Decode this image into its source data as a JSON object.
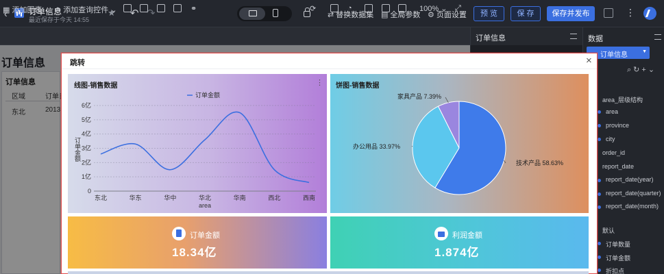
{
  "header": {
    "title": "订单信息",
    "subtitle": "最近保存于今天 14:55",
    "actions": [
      "替换数据集",
      "全局参数",
      "页面设置"
    ],
    "preview_label": "预 览",
    "save_label": "保 存",
    "publish_label": "保存并发布"
  },
  "toolbar": {
    "add_chart": "添加图表",
    "add_query": "添加查询控件",
    "zoom": "100%"
  },
  "canvas": {
    "page_title": "订单信息",
    "card_title": "订单信息",
    "columns": [
      "区域",
      "订单日"
    ],
    "row": [
      "东北",
      "2013"
    ]
  },
  "middle_panel": {
    "title": "订单信息"
  },
  "data_panel": {
    "title": "数据",
    "dataset": "订单信息",
    "fields": [
      "area_层级结构",
      "area",
      "province",
      "city",
      "order_id",
      "report_date",
      "report_date(year)",
      "report_date(quarter)",
      "report_date(month)"
    ],
    "group_label": "默认",
    "measures": [
      "订单数量",
      "订单金额",
      "折扣点"
    ]
  },
  "modal": {
    "title": "跳转",
    "close": "×"
  },
  "line_card": {
    "title": "线图-销售数据",
    "more": "⋮"
  },
  "pie_card": {
    "title": "饼图-销售数据"
  },
  "kpi": [
    {
      "label": "订单金额",
      "value": "18.34亿"
    },
    {
      "label": "利润金额",
      "value": "1.874亿"
    }
  ],
  "chart_data": [
    {
      "type": "line",
      "title": "线图-销售数据",
      "categories": [
        "东北",
        "华东",
        "华中",
        "华北",
        "华南",
        "西北",
        "西南"
      ],
      "series": [
        {
          "name": "订单金额",
          "values": [
            2.6,
            3.3,
            1.5,
            3.6,
            5.5,
            1.5,
            0.6
          ],
          "color": "#3b6fe0"
        }
      ],
      "xlabel": "area",
      "ylabel": "订单金额",
      "yticks": [
        "0",
        "1亿",
        "2亿",
        "3亿",
        "4亿",
        "5亿",
        "6亿"
      ],
      "ylim": [
        0,
        6
      ],
      "legend": "top",
      "grid": true
    },
    {
      "type": "pie",
      "title": "饼图-销售数据",
      "slices": [
        {
          "label": "技术产品",
          "value": 58.63,
          "text": "技术产品 58.63%",
          "color": "#3f7bea"
        },
        {
          "label": "办公用品",
          "value": 33.97,
          "text": "办公用品 33.97%",
          "color": "#5bc7ee"
        },
        {
          "label": "家具产品",
          "value": 7.39,
          "text": "家具产品 7.39%",
          "color": "#9a86df"
        }
      ]
    }
  ]
}
